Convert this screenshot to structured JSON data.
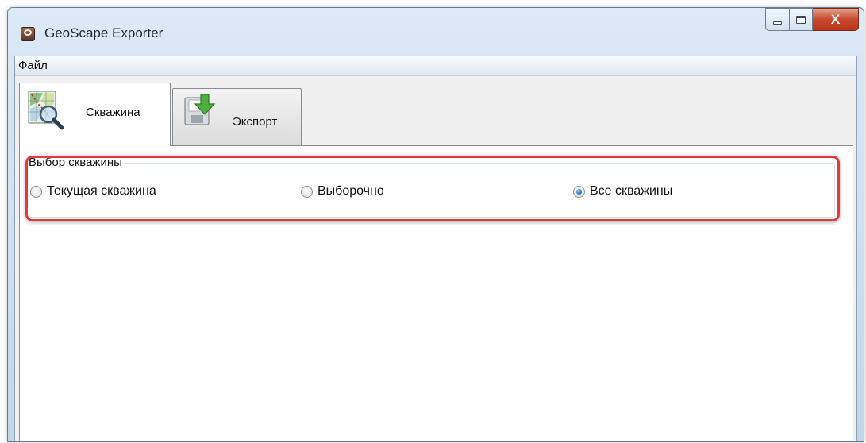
{
  "window": {
    "title": "GeoScape Exporter",
    "icons": {
      "app": "geoscape-app-icon",
      "minimize": "minimize-icon",
      "maximize": "maximize-icon",
      "close": "close-icon"
    },
    "close_glyph": "X"
  },
  "menubar": {
    "items": [
      {
        "label": "Файл"
      }
    ]
  },
  "tabs": [
    {
      "label": "Скважина",
      "icon": "well-map-search-icon",
      "selected": true
    },
    {
      "label": "Экспорт",
      "icon": "export-download-icon",
      "selected": false
    }
  ],
  "well_selection": {
    "caption": "Выбор скважины",
    "options": [
      {
        "label": "Текущая скважина",
        "checked": false
      },
      {
        "label": "Выборочно",
        "checked": false
      },
      {
        "label": "Все скважины",
        "checked": true
      }
    ]
  },
  "colors": {
    "highlight": "#e5383e",
    "close_button": "#c94a30",
    "radio_selected": "#1c62b8"
  }
}
